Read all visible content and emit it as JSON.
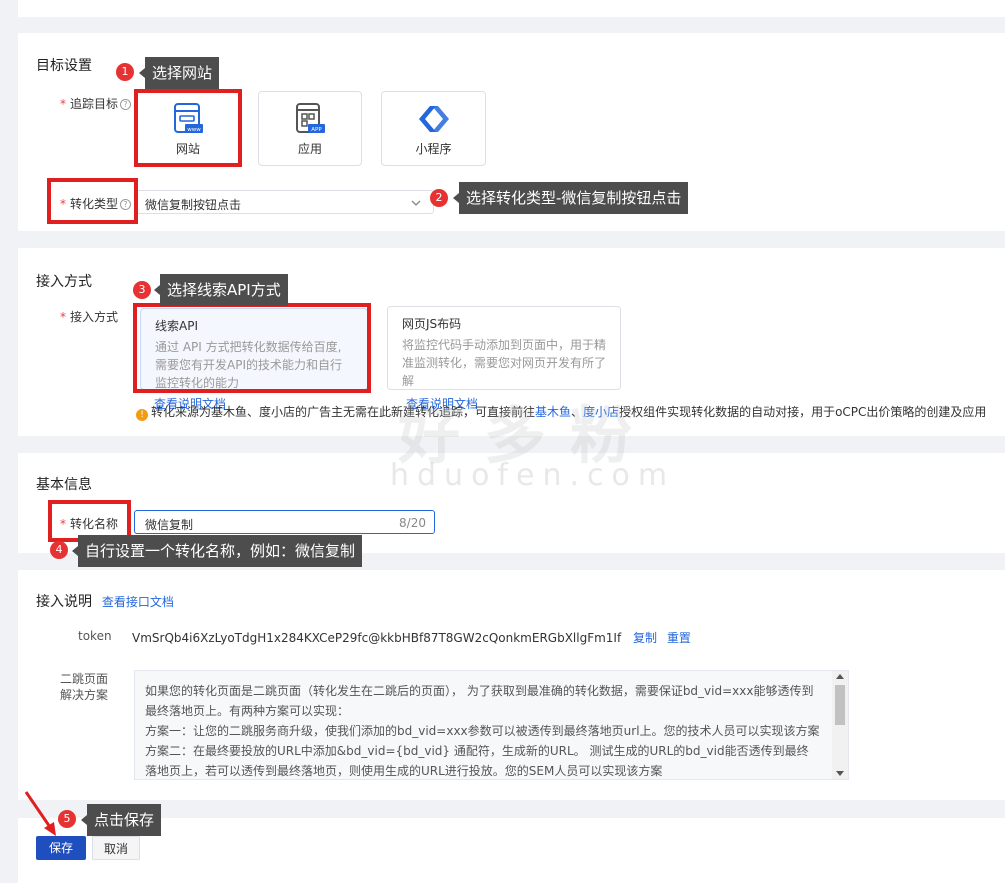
{
  "target": {
    "section_title": "目标设置",
    "track_label": "追踪目标",
    "options": [
      "网站",
      "应用",
      "小程序"
    ],
    "conv_type_label": "转化类型",
    "conv_type_value": "微信复制按钮点击"
  },
  "access": {
    "section_title": "接入方式",
    "field_label": "接入方式",
    "api_title": "线索API",
    "api_desc": "通过 API 方式把转化数据传给百度,需要您有开发API的技术能力和自行监控转化的能力",
    "js_title": "网页JS布码",
    "js_desc": "将监控代码手动添加到页面中，用于精准监测转化，需要您对网页开发有所了解",
    "doc_link": "查看说明文档",
    "notice_prefix": "转化来源为基木鱼、度小店的广告主无需在此新建转化追踪，可直接前往",
    "notice_link1": "基木鱼",
    "notice_sep": "、",
    "notice_link2": "度小店",
    "notice_suffix": "授权组件实现转化数据的自动对接，用于oCPC出价策略的创建及应用"
  },
  "basic": {
    "section_title": "基本信息",
    "name_label": "转化名称",
    "name_value": "微信复制",
    "name_count": "8/20"
  },
  "instructions": {
    "section_title": "接入说明",
    "doc_link": "查看接口文档",
    "token_label": "token",
    "token_value": "VmSrQb4i6XzLyoTdgH1x284KXCeP29fc@kkbHBf87T8GW2cQonkmERGbXllgFm1If",
    "copy_link": "复制",
    "reset_link": "重置",
    "redirect_label_1": "二跳页面",
    "redirect_label_2": "解决方案",
    "redirect_text": "如果您的转化页面是二跳页面（转化发生在二跳后的页面）， 为了获取到最准确的转化数据，需要保证bd_vid=xxx能够透传到最终落地页上。有两种方案可以实现：\n方案一：让您的二跳服务商升级，使我们添加的bd_vid=xxx参数可以被透传到最终落地页url上。您的技术人员可以实现该方案\n方案二：在最终要投放的URL中添加&bd_vid={bd_vid} 通配符，生成新的URL。 测试生成的URL的bd_vid能否透传到最终落地页上，若可以透传到最终落地页，则使用生成的URL进行投放。您的SEM人员可以实现该方案"
  },
  "actions": {
    "save": "保存",
    "cancel": "取消"
  },
  "annotations": {
    "n1": "1",
    "t1": "选择网站",
    "n2": "2",
    "t2": "选择转化类型-微信复制按钮点击",
    "n3": "3",
    "t3": "选择线索API方式",
    "n4": "4",
    "t4": "自行设置一个转化名称，例如：微信复制",
    "n5": "5",
    "t5": "点击保存"
  },
  "watermark": {
    "cn": "好多粉",
    "en": "hduofen.com"
  },
  "colors": {
    "accent": "#2467dc",
    "annotation_red": "#e02020",
    "tooltip_bg": "#4d4d4d",
    "primary_button": "#1f4fbf",
    "notice_orange": "#f39c12"
  }
}
